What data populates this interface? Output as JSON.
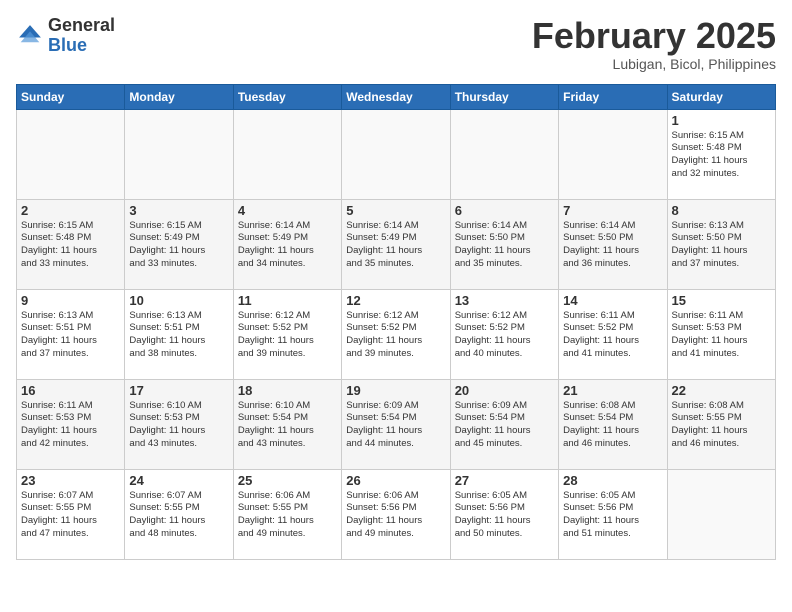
{
  "logo": {
    "general": "General",
    "blue": "Blue"
  },
  "title": "February 2025",
  "location": "Lubigan, Bicol, Philippines",
  "days_of_week": [
    "Sunday",
    "Monday",
    "Tuesday",
    "Wednesday",
    "Thursday",
    "Friday",
    "Saturday"
  ],
  "weeks": [
    [
      {
        "day": "",
        "info": ""
      },
      {
        "day": "",
        "info": ""
      },
      {
        "day": "",
        "info": ""
      },
      {
        "day": "",
        "info": ""
      },
      {
        "day": "",
        "info": ""
      },
      {
        "day": "",
        "info": ""
      },
      {
        "day": "1",
        "info": "Sunrise: 6:15 AM\nSunset: 5:48 PM\nDaylight: 11 hours\nand 32 minutes."
      }
    ],
    [
      {
        "day": "2",
        "info": "Sunrise: 6:15 AM\nSunset: 5:48 PM\nDaylight: 11 hours\nand 33 minutes."
      },
      {
        "day": "3",
        "info": "Sunrise: 6:15 AM\nSunset: 5:49 PM\nDaylight: 11 hours\nand 33 minutes."
      },
      {
        "day": "4",
        "info": "Sunrise: 6:14 AM\nSunset: 5:49 PM\nDaylight: 11 hours\nand 34 minutes."
      },
      {
        "day": "5",
        "info": "Sunrise: 6:14 AM\nSunset: 5:49 PM\nDaylight: 11 hours\nand 35 minutes."
      },
      {
        "day": "6",
        "info": "Sunrise: 6:14 AM\nSunset: 5:50 PM\nDaylight: 11 hours\nand 35 minutes."
      },
      {
        "day": "7",
        "info": "Sunrise: 6:14 AM\nSunset: 5:50 PM\nDaylight: 11 hours\nand 36 minutes."
      },
      {
        "day": "8",
        "info": "Sunrise: 6:13 AM\nSunset: 5:50 PM\nDaylight: 11 hours\nand 37 minutes."
      }
    ],
    [
      {
        "day": "9",
        "info": "Sunrise: 6:13 AM\nSunset: 5:51 PM\nDaylight: 11 hours\nand 37 minutes."
      },
      {
        "day": "10",
        "info": "Sunrise: 6:13 AM\nSunset: 5:51 PM\nDaylight: 11 hours\nand 38 minutes."
      },
      {
        "day": "11",
        "info": "Sunrise: 6:12 AM\nSunset: 5:52 PM\nDaylight: 11 hours\nand 39 minutes."
      },
      {
        "day": "12",
        "info": "Sunrise: 6:12 AM\nSunset: 5:52 PM\nDaylight: 11 hours\nand 39 minutes."
      },
      {
        "day": "13",
        "info": "Sunrise: 6:12 AM\nSunset: 5:52 PM\nDaylight: 11 hours\nand 40 minutes."
      },
      {
        "day": "14",
        "info": "Sunrise: 6:11 AM\nSunset: 5:52 PM\nDaylight: 11 hours\nand 41 minutes."
      },
      {
        "day": "15",
        "info": "Sunrise: 6:11 AM\nSunset: 5:53 PM\nDaylight: 11 hours\nand 41 minutes."
      }
    ],
    [
      {
        "day": "16",
        "info": "Sunrise: 6:11 AM\nSunset: 5:53 PM\nDaylight: 11 hours\nand 42 minutes."
      },
      {
        "day": "17",
        "info": "Sunrise: 6:10 AM\nSunset: 5:53 PM\nDaylight: 11 hours\nand 43 minutes."
      },
      {
        "day": "18",
        "info": "Sunrise: 6:10 AM\nSunset: 5:54 PM\nDaylight: 11 hours\nand 43 minutes."
      },
      {
        "day": "19",
        "info": "Sunrise: 6:09 AM\nSunset: 5:54 PM\nDaylight: 11 hours\nand 44 minutes."
      },
      {
        "day": "20",
        "info": "Sunrise: 6:09 AM\nSunset: 5:54 PM\nDaylight: 11 hours\nand 45 minutes."
      },
      {
        "day": "21",
        "info": "Sunrise: 6:08 AM\nSunset: 5:54 PM\nDaylight: 11 hours\nand 46 minutes."
      },
      {
        "day": "22",
        "info": "Sunrise: 6:08 AM\nSunset: 5:55 PM\nDaylight: 11 hours\nand 46 minutes."
      }
    ],
    [
      {
        "day": "23",
        "info": "Sunrise: 6:07 AM\nSunset: 5:55 PM\nDaylight: 11 hours\nand 47 minutes."
      },
      {
        "day": "24",
        "info": "Sunrise: 6:07 AM\nSunset: 5:55 PM\nDaylight: 11 hours\nand 48 minutes."
      },
      {
        "day": "25",
        "info": "Sunrise: 6:06 AM\nSunset: 5:55 PM\nDaylight: 11 hours\nand 49 minutes."
      },
      {
        "day": "26",
        "info": "Sunrise: 6:06 AM\nSunset: 5:56 PM\nDaylight: 11 hours\nand 49 minutes."
      },
      {
        "day": "27",
        "info": "Sunrise: 6:05 AM\nSunset: 5:56 PM\nDaylight: 11 hours\nand 50 minutes."
      },
      {
        "day": "28",
        "info": "Sunrise: 6:05 AM\nSunset: 5:56 PM\nDaylight: 11 hours\nand 51 minutes."
      },
      {
        "day": "",
        "info": ""
      }
    ]
  ]
}
